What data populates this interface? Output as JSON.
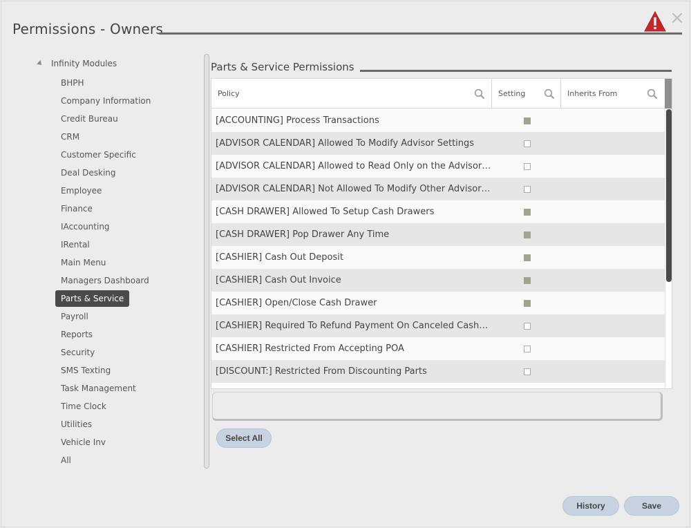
{
  "window": {
    "title": "Permissions - Owners",
    "close_glyph": "×"
  },
  "tree": {
    "root_label": "Infinity Modules",
    "items": [
      {
        "label": "BHPH",
        "active": false
      },
      {
        "label": "Company Information",
        "active": false
      },
      {
        "label": "Credit Bureau",
        "active": false
      },
      {
        "label": "CRM",
        "active": false
      },
      {
        "label": "Customer Specific",
        "active": false
      },
      {
        "label": "Deal Desking",
        "active": false
      },
      {
        "label": "Employee",
        "active": false
      },
      {
        "label": "Finance",
        "active": false
      },
      {
        "label": "IAccounting",
        "active": false
      },
      {
        "label": "IRental",
        "active": false
      },
      {
        "label": "Main Menu",
        "active": false
      },
      {
        "label": "Managers Dashboard",
        "active": false
      },
      {
        "label": "Parts & Service",
        "active": true
      },
      {
        "label": "Payroll",
        "active": false
      },
      {
        "label": "Reports",
        "active": false
      },
      {
        "label": "Security",
        "active": false
      },
      {
        "label": "SMS Texting",
        "active": false
      },
      {
        "label": "Task Management",
        "active": false
      },
      {
        "label": "Time Clock",
        "active": false
      },
      {
        "label": "Utilities",
        "active": false
      },
      {
        "label": "Vehicle Inv",
        "active": false
      },
      {
        "label": "All",
        "active": false
      }
    ]
  },
  "section": {
    "title": "Parts & Service Permissions"
  },
  "grid": {
    "columns": {
      "policy": "Policy",
      "setting": "Setting",
      "inherits_from": "Inherits From"
    },
    "rows": [
      {
        "policy": "[ACCOUNTING] Process Transactions",
        "setting": true,
        "inherits_from": ""
      },
      {
        "policy": "[ADVISOR CALENDAR] Allowed To Modify Advisor Settings",
        "setting": false,
        "inherits_from": ""
      },
      {
        "policy": "[ADVISOR CALENDAR] Allowed to Read Only on the Advisor Ca...",
        "setting": false,
        "inherits_from": ""
      },
      {
        "policy": "[ADVISOR CALENDAR] Not Allowed To Modify Other Advisor A...",
        "setting": false,
        "inherits_from": ""
      },
      {
        "policy": "[CASH DRAWER] Allowed To Setup Cash Drawers",
        "setting": true,
        "inherits_from": ""
      },
      {
        "policy": "[CASH DRAWER] Pop Drawer Any Time",
        "setting": true,
        "inherits_from": ""
      },
      {
        "policy": "[CASHIER] Cash Out Deposit",
        "setting": true,
        "inherits_from": ""
      },
      {
        "policy": "[CASHIER] Cash Out Invoice",
        "setting": true,
        "inherits_from": ""
      },
      {
        "policy": "[CASHIER] Open/Close Cash Drawer",
        "setting": true,
        "inherits_from": ""
      },
      {
        "policy": "[CASHIER] Required To Refund Payment On Canceled Cashout.",
        "setting": false,
        "inherits_from": ""
      },
      {
        "policy": "[CASHIER] Restricted From Accepting POA",
        "setting": false,
        "inherits_from": ""
      },
      {
        "policy": "[DISCOUNT:] Restricted From Discounting Parts",
        "setting": false,
        "inherits_from": ""
      }
    ]
  },
  "buttons": {
    "select_all": "Select All",
    "history": "History",
    "save": "Save"
  },
  "colors": {
    "checked": "#a2a48f",
    "button_bg": "#c8d3e1",
    "warning": "#c0282d",
    "active_item": "#4a4a4a"
  },
  "icons": [
    "warning-icon",
    "close-icon",
    "search-icon",
    "expand-caret-icon"
  ]
}
